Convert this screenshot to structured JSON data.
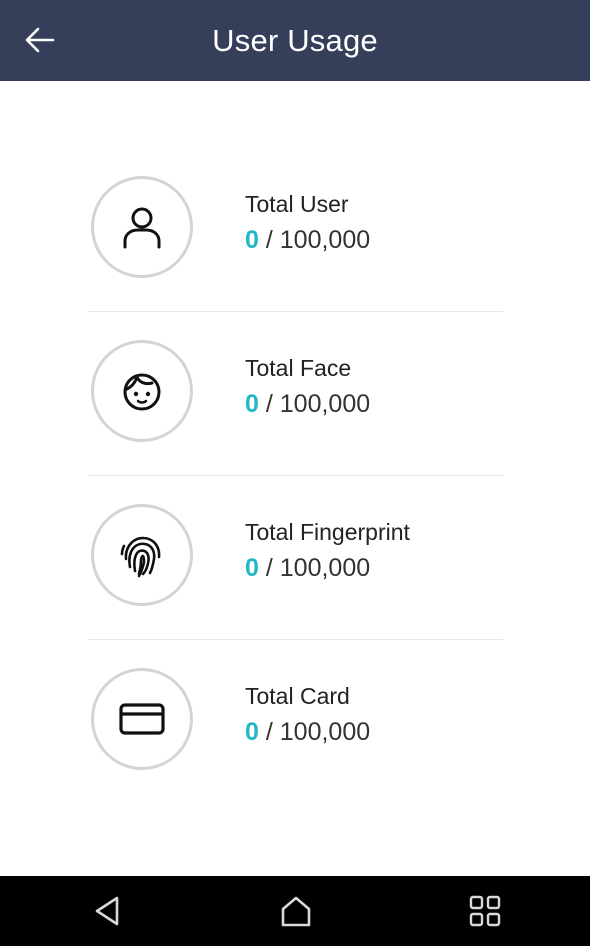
{
  "header": {
    "title": "User Usage",
    "back_icon": "arrow-left-icon"
  },
  "accent_color": "#22b8c8",
  "header_color": "#363f5a",
  "items": [
    {
      "label": "Total User",
      "current": "0",
      "separator": "/",
      "max": "100,000",
      "icon": "user-icon"
    },
    {
      "label": "Total Face",
      "current": "0",
      "separator": "/",
      "max": "100,000",
      "icon": "face-icon"
    },
    {
      "label": "Total Fingerprint",
      "current": "0",
      "separator": "/",
      "max": "100,000",
      "icon": "fingerprint-icon"
    },
    {
      "label": "Total Card",
      "current": "0",
      "separator": "/",
      "max": "100,000",
      "icon": "card-icon"
    }
  ],
  "navbar": {
    "buttons": [
      "back-triangle-icon",
      "home-icon",
      "apps-grid-icon"
    ]
  }
}
